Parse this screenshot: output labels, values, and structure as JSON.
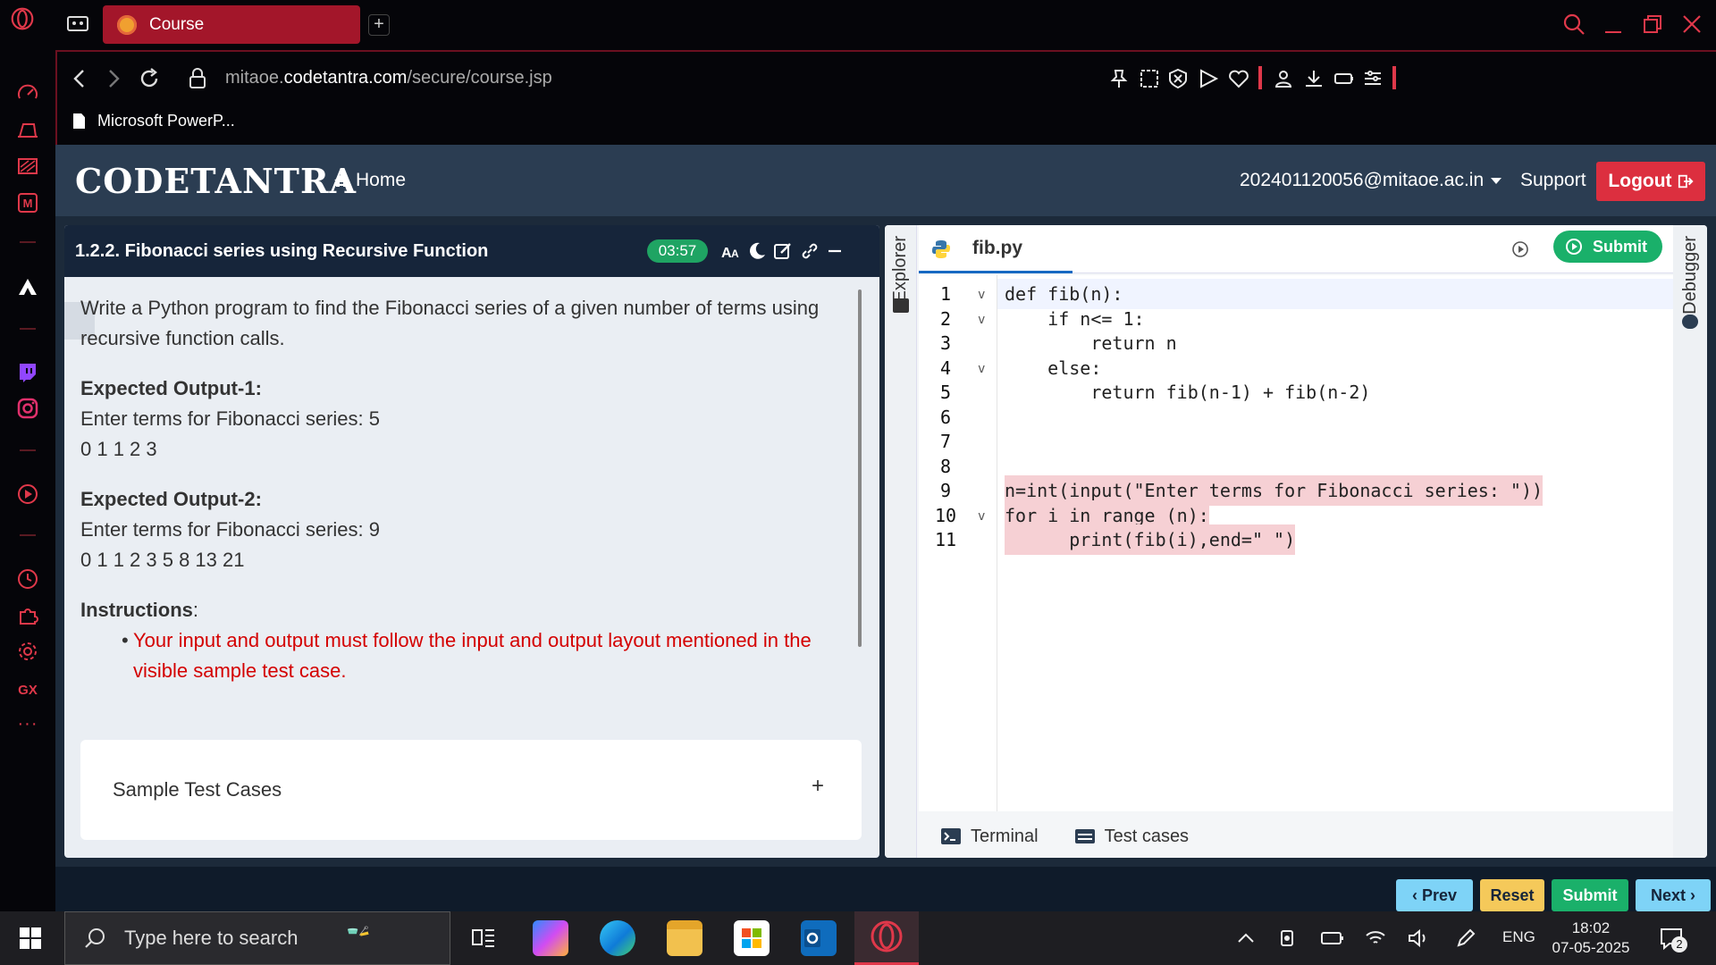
{
  "browser": {
    "tab_title": "Course",
    "url_host_prefix": "mitaoe.",
    "url_host_main": "codetantra.com",
    "url_path": "/secure/course.jsp",
    "bookmark": "Microsoft PowerP...",
    "new_tab_label": "+"
  },
  "site": {
    "logo_text": "CODETANTRA",
    "home_label": "Home",
    "user_email": "202401120056@mitaoe.ac.in",
    "support_label": "Support",
    "logout_label": "Logout"
  },
  "question": {
    "title": "1.2.2. Fibonacci series using Recursive Function",
    "timer": "03:57",
    "description": "Write a Python program to find the Fibonacci series of a given number of terms using recursive function calls.",
    "output1_heading": "Expected Output-1:",
    "output1_line1": "Enter terms for Fibonacci series: 5",
    "output1_line2": "0 1 1 2 3",
    "output2_heading": "Expected Output-2:",
    "output2_line1": "Enter terms for Fibonacci series: 9",
    "output2_line2": "0 1 1 2 3 5 8 13 21",
    "instructions_heading": "Instructions",
    "instructions_colon": ":",
    "instruction_bullet": "•",
    "instruction_1": "Your input and output must follow the input and output layout mentioned in the visible sample test case.",
    "sample_test_cases_label": "Sample Test Cases",
    "sample_test_cases_toggle": "+"
  },
  "editor": {
    "explorer_label": "Explorer",
    "debugger_label": "Debugger",
    "file_name": "fib.py",
    "submit_label": "Submit",
    "terminal_label": "Terminal",
    "test_cases_label": "Test cases",
    "line_numbers": [
      "1",
      "2",
      "3",
      "4",
      "5",
      "6",
      "7",
      "8",
      "9",
      "10",
      "11"
    ],
    "fold_marker": "v",
    "code_lines": [
      "def fib(n):",
      "    if n<= 1:",
      "        return n",
      "    else:",
      "        return fib(n-1) + fib(n-2)",
      "",
      "",
      "",
      "n=int(input(\"Enter terms for Fibonacci series: \"))",
      "for i in range (n):",
      "      print(fib(i),end=\" \")"
    ]
  },
  "footer_buttons": {
    "prev": "‹ Prev",
    "reset": "Reset",
    "submit": "Submit",
    "next": "Next ›"
  },
  "taskbar": {
    "search_placeholder": "Type here to search",
    "language": "ENG",
    "time": "18:02",
    "date": "07-05-2025",
    "notification_count": "2"
  },
  "colors": {
    "opera_red": "#e0384a",
    "header_bg": "#2b3d52",
    "question_header_bg": "#16253a",
    "timer_green": "#1fa463",
    "logout_red": "#dc2f3f",
    "submit_green": "#1ab06a",
    "prev_blue": "#7ed3f7",
    "reset_yellow": "#f5c95a",
    "instruction_red": "#d40000"
  },
  "icons": [
    "opera-logo-icon",
    "tab-favicon-icon",
    "back-icon",
    "forward-icon",
    "reload-icon",
    "lock-icon",
    "home-icon",
    "timer-icon",
    "font-size-icon",
    "moon-icon",
    "edit-icon",
    "link-icon",
    "minimize-icon",
    "python-icon",
    "run-icon",
    "terminal-icon",
    "test-cases-icon",
    "windows-icon",
    "search-icon"
  ]
}
